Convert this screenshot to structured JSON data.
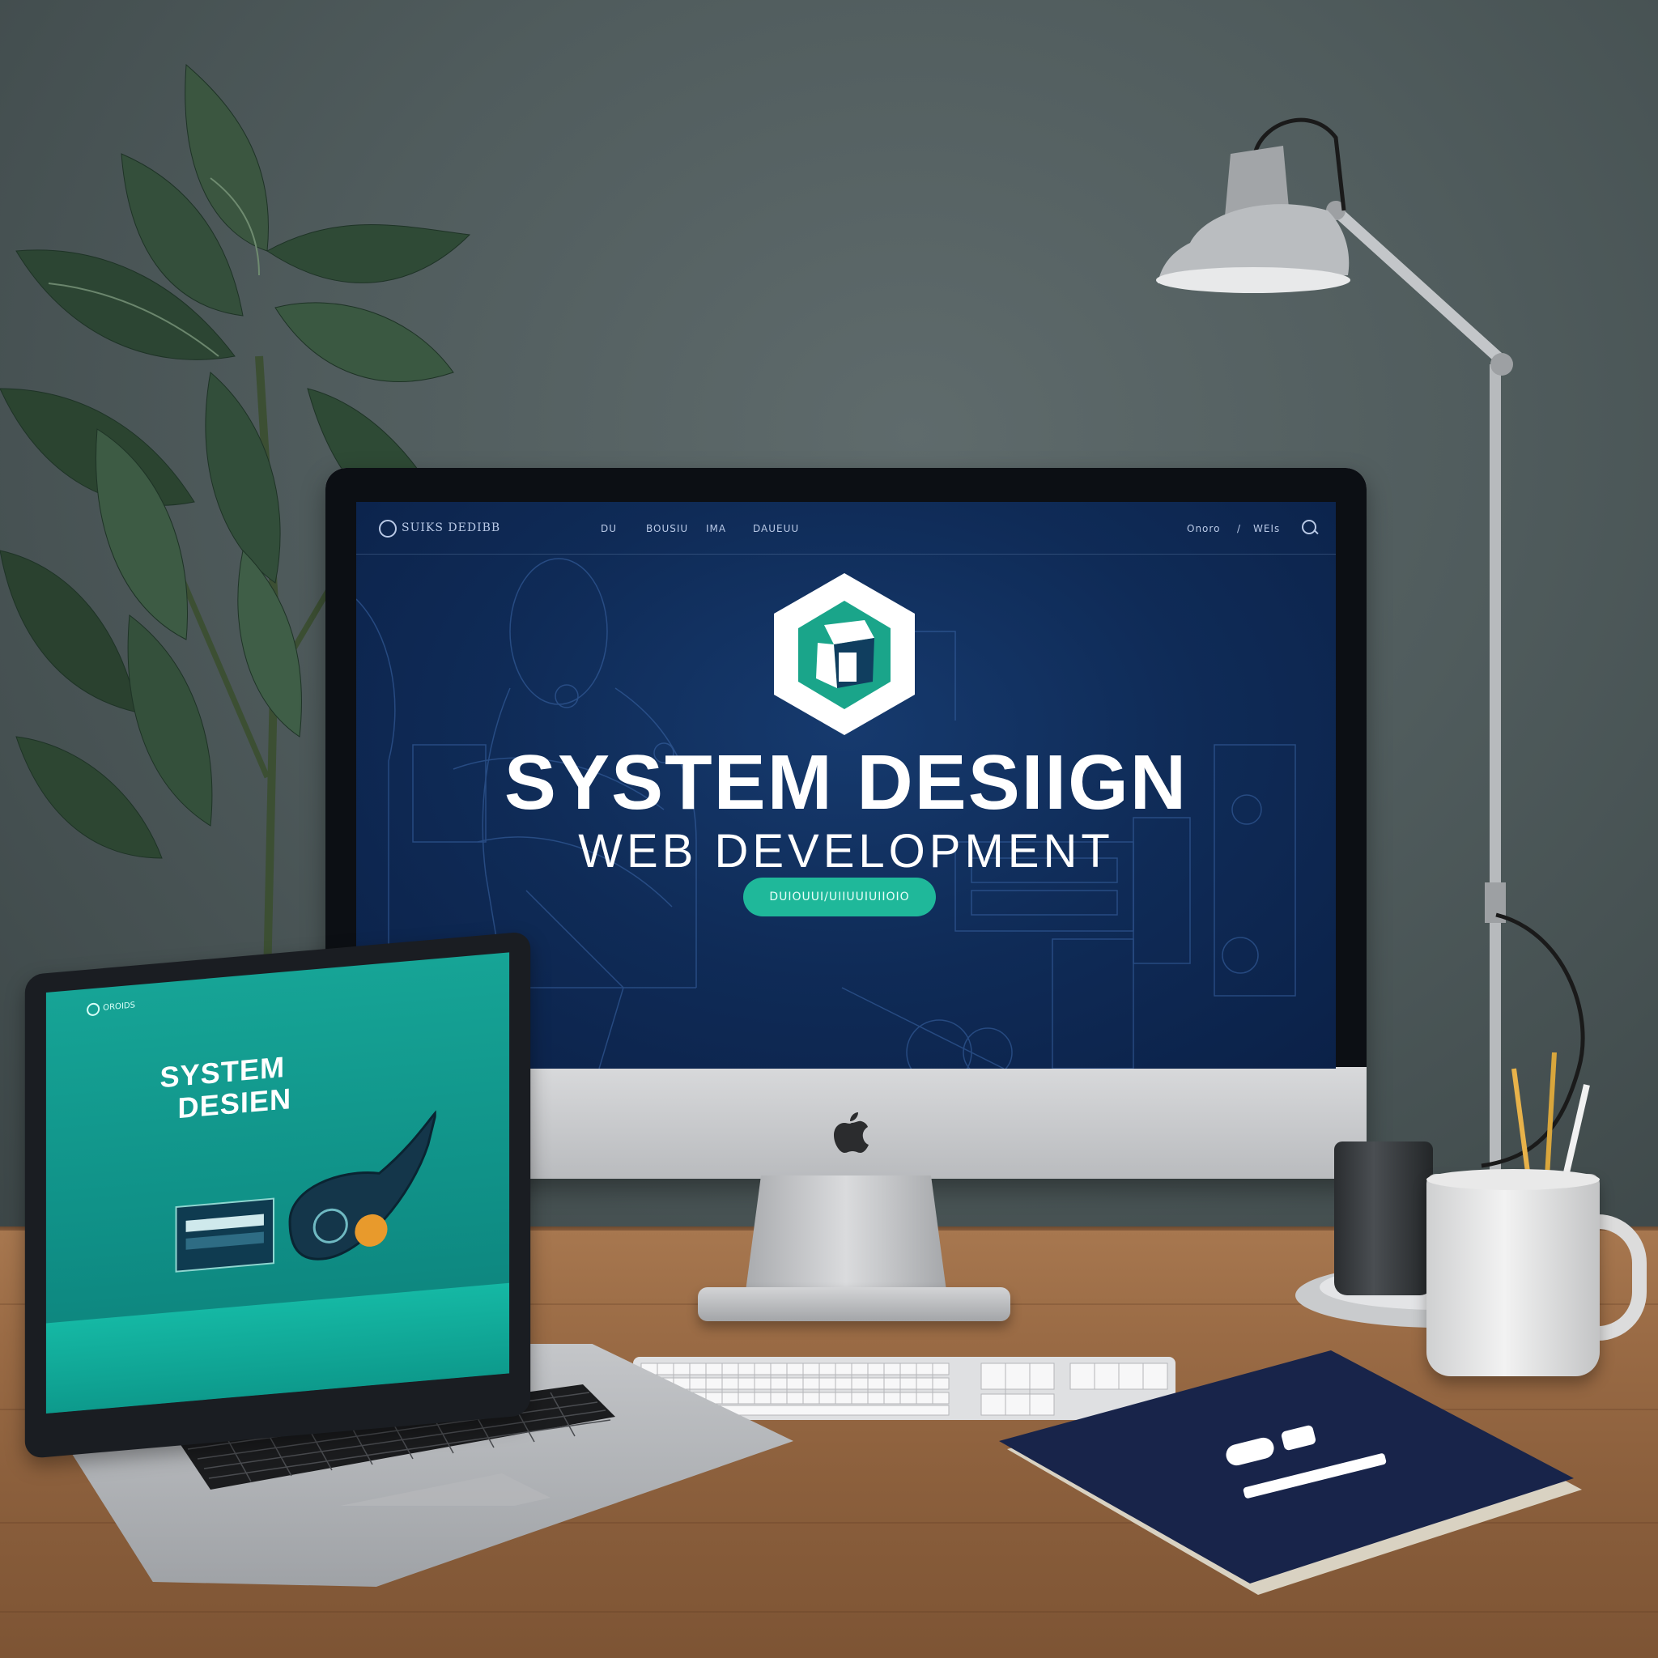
{
  "imac": {
    "nav": {
      "brand": "SUIKS DEDIBB",
      "links": [
        "DU",
        "BOUSIU",
        "IMA",
        "DAUEUU"
      ],
      "right_links": [
        "Onoro",
        "/",
        "WEIs"
      ]
    },
    "hero": {
      "title": "SYSTEM DESIIGN",
      "subtitle": "WEB  DEVELOPMENT",
      "cta_label": "DUIOUUI/UIIUUIUIIOIO"
    }
  },
  "laptop": {
    "nav": {
      "brand": "OROIDS"
    },
    "hero": {
      "title_line1": "SYSTEM",
      "title_line2": "DESIEN"
    }
  },
  "colors": {
    "wall": "#505c5d",
    "desk": "#9a6b45",
    "imac_screen": "#0f2b57",
    "accent_teal": "#1fb89a",
    "laptop_screen": "#0f8f86",
    "notebook": "#18244a"
  }
}
